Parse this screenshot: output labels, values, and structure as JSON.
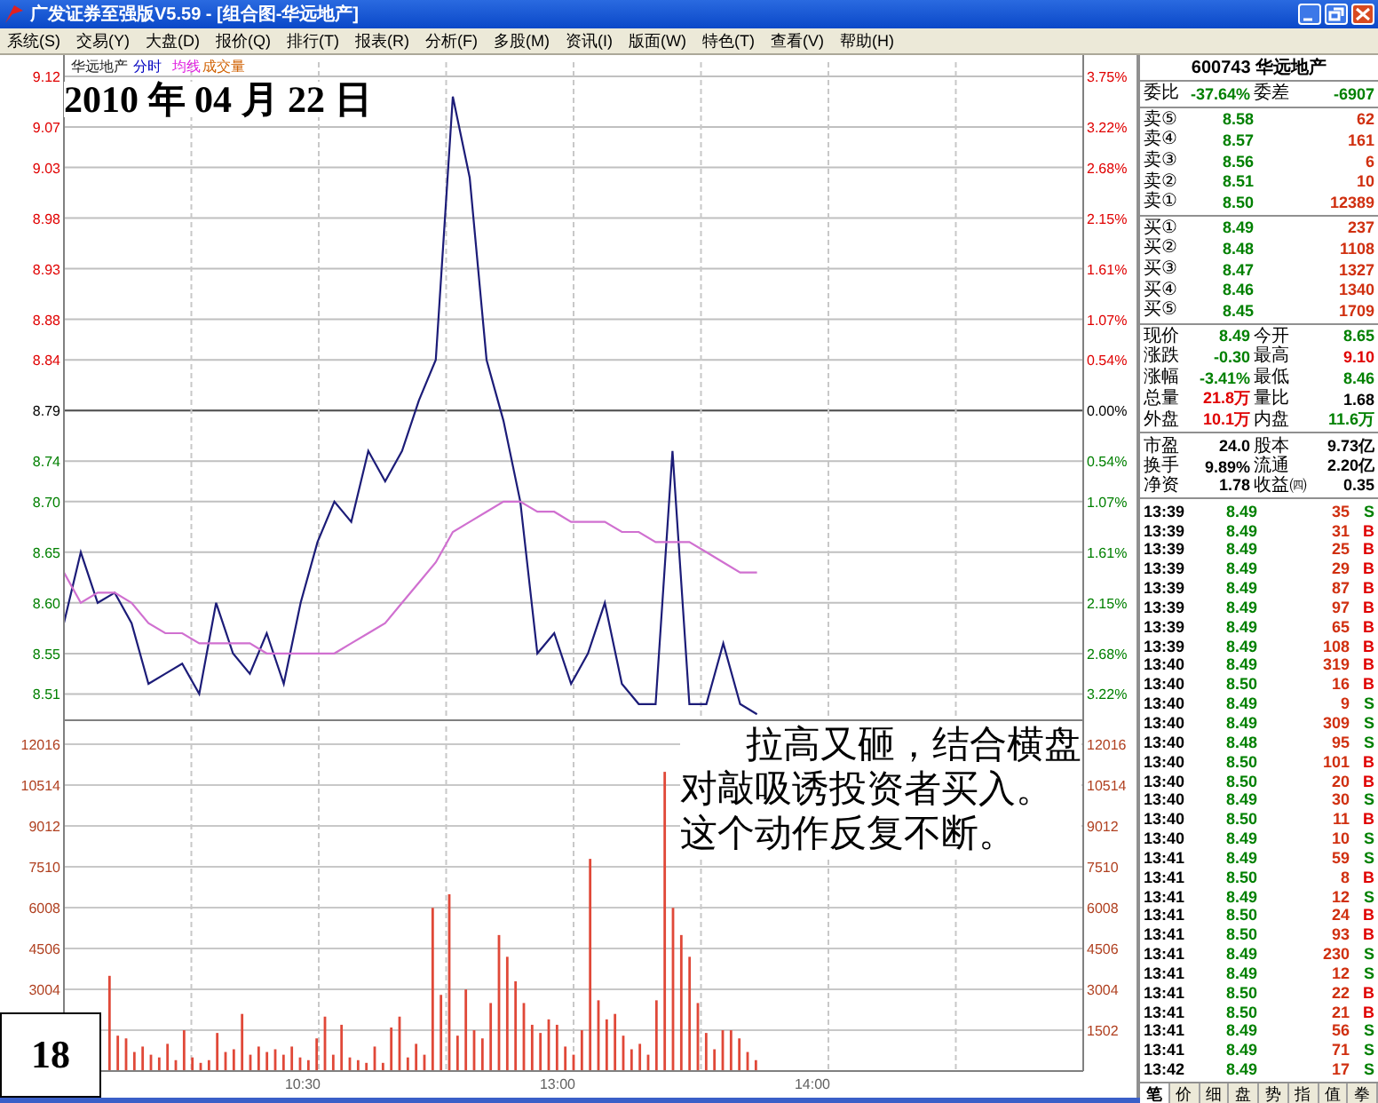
{
  "window": {
    "title": "广发证券至强版V5.59 - [组合图-华远地产]"
  },
  "menu": [
    "系统(S)",
    "交易(Y)",
    "大盘(D)",
    "报价(Q)",
    "排行(T)",
    "报表(R)",
    "分析(F)",
    "多股(M)",
    "资讯(I)",
    "版面(W)",
    "特色(T)",
    "查看(V)",
    "帮助(H)"
  ],
  "chart": {
    "legend": [
      {
        "label": "华远地产",
        "color": "#202020"
      },
      {
        "label": "分时",
        "color": "#0000c0"
      },
      {
        "label": "均线",
        "color": "#e020e0"
      },
      {
        "label": "成交量",
        "color": "#d06000"
      }
    ],
    "price_chart": {
      "chart_data": {
        "type": "line",
        "grid": true,
        "categories": [
          null,
          null,
          null,
          null,
          null,
          null,
          null,
          null,
          null,
          null,
          null,
          null,
          null,
          null,
          null,
          null,
          null,
          null,
          null,
          null,
          null,
          null,
          null,
          null,
          null,
          null,
          null,
          null,
          null,
          null,
          null,
          null,
          null,
          null,
          null,
          null,
          null,
          null,
          null,
          null,
          null,
          null
        ],
        "series": [
          {
            "color": "#1c1c78",
            "values": [
              8.58,
              8.65,
              8.6,
              8.61,
              8.58,
              8.52,
              8.53,
              8.54,
              8.51,
              8.6,
              8.55,
              8.53,
              8.57,
              8.52,
              8.6,
              8.66,
              8.7,
              8.68,
              8.75,
              8.72,
              8.75,
              8.8,
              8.84,
              9.1,
              9.02,
              8.84,
              8.78,
              8.7,
              8.55,
              8.57,
              8.52,
              8.55,
              8.6,
              8.52,
              8.5,
              8.5,
              8.75,
              8.5,
              8.5,
              8.56,
              8.5,
              8.49
            ]
          },
          {
            "color": "#d070d0",
            "values": [
              8.63,
              8.6,
              8.61,
              8.61,
              8.6,
              8.58,
              8.57,
              8.57,
              8.56,
              8.56,
              8.56,
              8.56,
              8.55,
              8.55,
              8.55,
              8.55,
              8.55,
              8.56,
              8.57,
              8.58,
              8.6,
              8.62,
              8.64,
              8.67,
              8.68,
              8.69,
              8.7,
              8.7,
              8.69,
              8.69,
              8.68,
              8.68,
              8.68,
              8.67,
              8.67,
              8.66,
              8.66,
              8.66,
              8.65,
              8.64,
              8.63,
              8.63
            ]
          }
        ],
        "ylim": [
          8.485,
          9.141
        ],
        "ref_lines": [
          {
            "axis": "y",
            "value": 8.79
          }
        ],
        "yticks": [
          {
            "value": 9.12,
            "label": "9.12"
          },
          {
            "value": 9.07,
            "label": "9.07"
          },
          {
            "value": 9.03,
            "label": "9.03"
          },
          {
            "value": 8.98,
            "label": "8.98"
          },
          {
            "value": 8.93,
            "label": "8.93"
          },
          {
            "value": 8.88,
            "label": "8.88"
          },
          {
            "value": 8.84,
            "label": "8.84"
          },
          {
            "value": 8.79,
            "label": "8.79"
          },
          {
            "value": 8.74,
            "label": "8.74"
          },
          {
            "value": 8.7,
            "label": "8.70"
          },
          {
            "value": 8.65,
            "label": "8.65"
          },
          {
            "value": 8.6,
            "label": "8.60"
          },
          {
            "value": 8.55,
            "label": "8.55"
          },
          {
            "value": 8.51,
            "label": "8.51"
          }
        ]
      }
    },
    "percent_labels": [
      {
        "label": "3.75%",
        "color": "#e00000"
      },
      {
        "label": "3.22%",
        "color": "#e00000"
      },
      {
        "label": "2.68%",
        "color": "#e00000"
      },
      {
        "label": "2.15%",
        "color": "#e00000"
      },
      {
        "label": "1.61%",
        "color": "#e00000"
      },
      {
        "label": "1.07%",
        "color": "#e00000"
      },
      {
        "label": "0.54%",
        "color": "#e00000"
      },
      {
        "label": "0.00%",
        "color": "#000000"
      },
      {
        "label": "0.54%",
        "color": "#008000"
      },
      {
        "label": "1.07%",
        "color": "#008000"
      },
      {
        "label": "1.61%",
        "color": "#008000"
      },
      {
        "label": "2.15%",
        "color": "#008000"
      },
      {
        "label": "2.68%",
        "color": "#008000"
      },
      {
        "label": "3.22%",
        "color": "#008000"
      }
    ],
    "volume_chart": {
      "chart_data": {
        "type": "bar",
        "grid": true,
        "categories": [
          null,
          null,
          null,
          null,
          null,
          null,
          null,
          null,
          null,
          null,
          null,
          null,
          null,
          null,
          null,
          null,
          null,
          null,
          null,
          null,
          null,
          null,
          null,
          null,
          null,
          null,
          null,
          null,
          null,
          null,
          null,
          null,
          null,
          null,
          null,
          null,
          null,
          null,
          null,
          null,
          null,
          null,
          null,
          null,
          null,
          null,
          null,
          null,
          null,
          null,
          null,
          null,
          null,
          null,
          null,
          null,
          null,
          null,
          null,
          null,
          null,
          null,
          null,
          null,
          null,
          null,
          null,
          null,
          null,
          null,
          null,
          null,
          null,
          null,
          null,
          null,
          null,
          null,
          null,
          null,
          null,
          null,
          null,
          null,
          null,
          null,
          null,
          null,
          null,
          null,
          null,
          null,
          null,
          null,
          null,
          null,
          null,
          null,
          null,
          null,
          null,
          null,
          null,
          null,
          null,
          null,
          null,
          null,
          null,
          null,
          null,
          null,
          null,
          null,
          null,
          null,
          null,
          null,
          null,
          null,
          null,
          null,
          null
        ],
        "series": [
          {
            "color": "#e04838",
            "values": [
              null,
              null,
              null,
              null,
              null,
              3500,
              1300,
              1200,
              700,
              900,
              600,
              500,
              1000,
              400,
              1500,
              500,
              300,
              400,
              1400,
              700,
              800,
              2100,
              600,
              900,
              700,
              800,
              600,
              900,
              500,
              400,
              1200,
              2000,
              600,
              1700,
              500,
              400,
              300,
              900,
              300,
              1600,
              2000,
              500,
              1000,
              600,
              6000,
              2800,
              6500,
              1300,
              3000,
              1500,
              1200,
              2500,
              5000,
              4200,
              3300,
              2500,
              1700,
              1400,
              1900,
              1700,
              900,
              600,
              1500,
              7800,
              2600,
              1900,
              2100,
              1300,
              800,
              1000,
              600,
              2600,
              11000,
              6000,
              5000,
              4200,
              2500,
              1400,
              800,
              1500,
              1500,
              1200,
              700,
              400,
              null,
              null,
              null,
              null,
              null,
              null,
              null,
              null,
              null,
              null,
              null,
              null,
              null,
              null,
              null,
              null,
              null,
              null,
              null,
              null,
              null,
              null,
              null,
              null,
              null,
              null,
              null,
              null,
              null,
              null,
              null,
              null,
              null,
              null,
              null,
              null,
              null,
              null,
              null
            ]
          }
        ],
        "ylim": [
          0,
          12930
        ],
        "yticks": [
          {
            "value": 12016,
            "label": "12016"
          },
          {
            "value": 10514,
            "label": "10514"
          },
          {
            "value": 9012,
            "label": "9012"
          },
          {
            "value": 7510,
            "label": "7510"
          },
          {
            "value": 6008,
            "label": "6008"
          },
          {
            "value": 4506,
            "label": "4506"
          },
          {
            "value": 3004,
            "label": "3004"
          }
        ]
      }
    },
    "volume_right_labels": [
      "12016",
      "10514",
      "9012",
      "7510",
      "6008",
      "4506",
      "3004",
      "1502"
    ],
    "time_labels": [
      "10:30",
      "13:00",
      "14:00"
    ]
  },
  "annotations": {
    "date": "2010 年 04 月 22 日",
    "caption": [
      "拉高又砸，结合横盘",
      "对敲吸诱投资者买入。",
      "这个动作反复不断。"
    ],
    "page_number": "18"
  },
  "quote": {
    "title": "600743 华远地产",
    "ratio": {
      "left": {
        "label": "委比",
        "value": "-37.64%",
        "color": "#008000"
      },
      "right": {
        "label": "委差",
        "value": "-6907",
        "color": "#008000"
      }
    },
    "asks": [
      {
        "label": "卖⑤",
        "price": "8.58",
        "volume": "62"
      },
      {
        "label": "卖④",
        "price": "8.57",
        "volume": "161"
      },
      {
        "label": "卖③",
        "price": "8.56",
        "volume": "6"
      },
      {
        "label": "卖②",
        "price": "8.51",
        "volume": "10"
      },
      {
        "label": "卖①",
        "price": "8.50",
        "volume": "12389"
      }
    ],
    "bids": [
      {
        "label": "买①",
        "price": "8.49",
        "volume": "237"
      },
      {
        "label": "买②",
        "price": "8.48",
        "volume": "1108"
      },
      {
        "label": "买③",
        "price": "8.47",
        "volume": "1327"
      },
      {
        "label": "买④",
        "price": "8.46",
        "volume": "1340"
      },
      {
        "label": "买⑤",
        "price": "8.45",
        "volume": "1709"
      }
    ],
    "stats": [
      {
        "left": {
          "label": "现价",
          "value": "8.49",
          "color": "#008000"
        },
        "right": {
          "label": "今开",
          "value": "8.65",
          "color": "#008000"
        }
      },
      {
        "left": {
          "label": "涨跌",
          "value": "-0.30",
          "color": "#008000"
        },
        "right": {
          "label": "最高",
          "value": "9.10",
          "color": "#e00000"
        }
      },
      {
        "left": {
          "label": "涨幅",
          "value": "-3.41%",
          "color": "#008000"
        },
        "right": {
          "label": "最低",
          "value": "8.46",
          "color": "#008000"
        }
      },
      {
        "left": {
          "label": "总量",
          "value": "21.8万",
          "color": "#e00000"
        },
        "right": {
          "label": "量比",
          "value": "1.68",
          "color": "#000000"
        }
      },
      {
        "left": {
          "label": "外盘",
          "value": "10.1万",
          "color": "#e00000"
        },
        "right": {
          "label": "内盘",
          "value": "11.6万",
          "color": "#008000"
        }
      }
    ],
    "fundamentals": [
      {
        "left": {
          "label": "市盈",
          "value": "24.0"
        },
        "right": {
          "label": "股本",
          "value": "9.73亿"
        }
      },
      {
        "left": {
          "label": "换手",
          "value": "9.89%"
        },
        "right": {
          "label": "流通",
          "value": "2.20亿"
        }
      },
      {
        "left": {
          "label": "净资",
          "value": "1.78"
        },
        "right": {
          "label": "收益㈣",
          "value": "0.35"
        }
      }
    ],
    "trades": [
      {
        "time": "13:39",
        "price": "8.49",
        "volume": "35",
        "side": "S",
        "buy": false
      },
      {
        "time": "13:39",
        "price": "8.49",
        "volume": "31",
        "side": "B",
        "buy": true
      },
      {
        "time": "13:39",
        "price": "8.49",
        "volume": "25",
        "side": "B",
        "buy": true
      },
      {
        "time": "13:39",
        "price": "8.49",
        "volume": "29",
        "side": "B",
        "buy": true
      },
      {
        "time": "13:39",
        "price": "8.49",
        "volume": "87",
        "side": "B",
        "buy": true
      },
      {
        "time": "13:39",
        "price": "8.49",
        "volume": "97",
        "side": "B",
        "buy": true
      },
      {
        "time": "13:39",
        "price": "8.49",
        "volume": "65",
        "side": "B",
        "buy": true
      },
      {
        "time": "13:39",
        "price": "8.49",
        "volume": "108",
        "side": "B",
        "buy": true
      },
      {
        "time": "13:40",
        "price": "8.49",
        "volume": "319",
        "side": "B",
        "buy": true
      },
      {
        "time": "13:40",
        "price": "8.50",
        "volume": "16",
        "side": "B",
        "buy": true
      },
      {
        "time": "13:40",
        "price": "8.49",
        "volume": "9",
        "side": "S",
        "buy": false
      },
      {
        "time": "13:40",
        "price": "8.49",
        "volume": "309",
        "side": "S",
        "buy": false
      },
      {
        "time": "13:40",
        "price": "8.48",
        "volume": "95",
        "side": "S",
        "buy": false
      },
      {
        "time": "13:40",
        "price": "8.50",
        "volume": "101",
        "side": "B",
        "buy": true
      },
      {
        "time": "13:40",
        "price": "8.50",
        "volume": "20",
        "side": "B",
        "buy": true
      },
      {
        "time": "13:40",
        "price": "8.49",
        "volume": "30",
        "side": "S",
        "buy": false
      },
      {
        "time": "13:40",
        "price": "8.50",
        "volume": "11",
        "side": "B",
        "buy": true
      },
      {
        "time": "13:40",
        "price": "8.49",
        "volume": "10",
        "side": "S",
        "buy": false
      },
      {
        "time": "13:41",
        "price": "8.49",
        "volume": "59",
        "side": "S",
        "buy": false
      },
      {
        "time": "13:41",
        "price": "8.50",
        "volume": "8",
        "side": "B",
        "buy": true
      },
      {
        "time": "13:41",
        "price": "8.49",
        "volume": "12",
        "side": "S",
        "buy": false
      },
      {
        "time": "13:41",
        "price": "8.50",
        "volume": "24",
        "side": "B",
        "buy": true
      },
      {
        "time": "13:41",
        "price": "8.50",
        "volume": "93",
        "side": "B",
        "buy": true
      },
      {
        "time": "13:41",
        "price": "8.49",
        "volume": "230",
        "side": "S",
        "buy": false
      },
      {
        "time": "13:41",
        "price": "8.49",
        "volume": "12",
        "side": "S",
        "buy": false
      },
      {
        "time": "13:41",
        "price": "8.50",
        "volume": "22",
        "side": "B",
        "buy": true
      },
      {
        "time": "13:41",
        "price": "8.50",
        "volume": "21",
        "side": "B",
        "buy": true
      },
      {
        "time": "13:41",
        "price": "8.49",
        "volume": "56",
        "side": "S",
        "buy": false
      },
      {
        "time": "13:41",
        "price": "8.49",
        "volume": "71",
        "side": "S",
        "buy": false
      },
      {
        "time": "13:42",
        "price": "8.49",
        "volume": "17",
        "side": "S",
        "buy": false
      }
    ],
    "panel_tabs": [
      {
        "label": "笔",
        "selected": true
      },
      {
        "label": "价",
        "selected": false
      },
      {
        "label": "细",
        "selected": false
      },
      {
        "label": "盘",
        "selected": false
      },
      {
        "label": "势",
        "selected": false
      },
      {
        "label": "指",
        "selected": false
      },
      {
        "label": "值",
        "selected": false
      },
      {
        "label": "拳",
        "selected": false
      }
    ]
  }
}
